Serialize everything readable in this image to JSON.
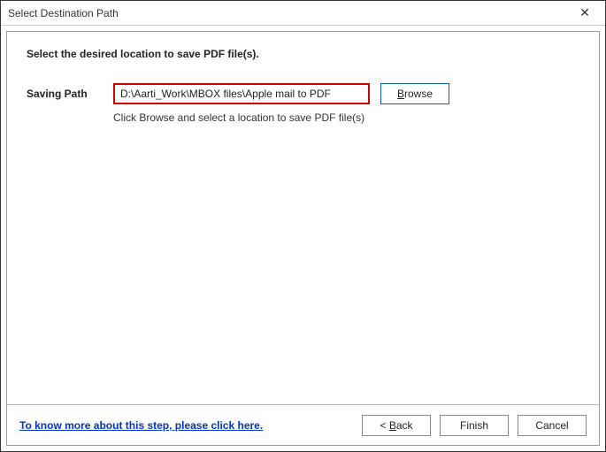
{
  "window": {
    "title": "Select Destination Path"
  },
  "instruction": "Select the desired location to save PDF file(s).",
  "path": {
    "label": "Saving Path",
    "value": "D:\\Aarti_Work\\MBOX files\\Apple mail to PDF",
    "browse_prefix": "B",
    "browse_rest": "rowse",
    "hint": "Click Browse and select a location to save PDF file(s)"
  },
  "help_link": "To know more about this step, please click here.",
  "buttons": {
    "back_prefix": "< ",
    "back_ul": "B",
    "back_rest": "ack",
    "finish": "Finish",
    "cancel": "Cancel"
  }
}
